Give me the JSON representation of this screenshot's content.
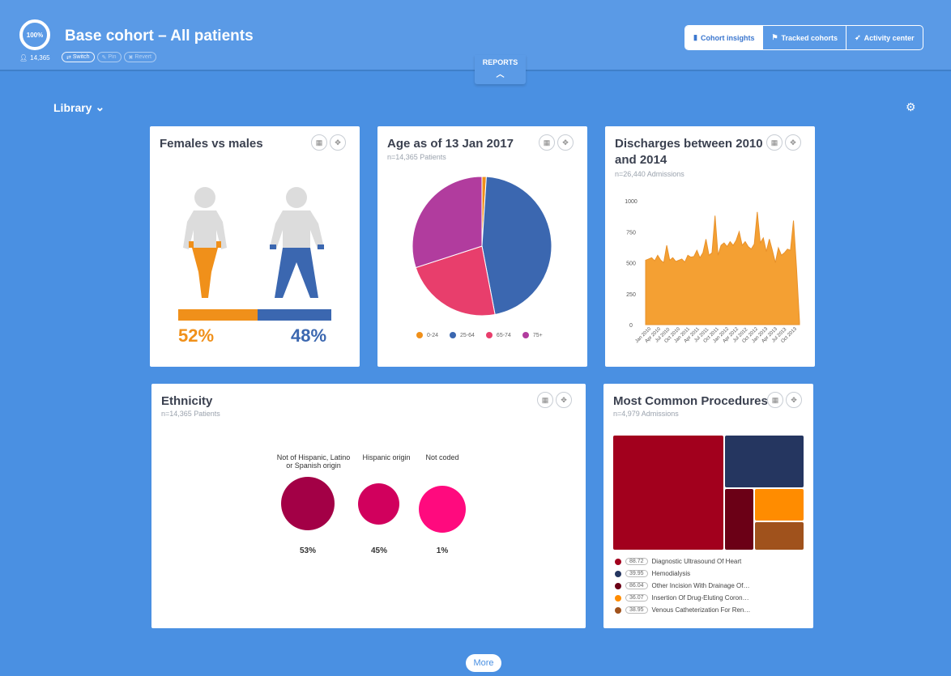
{
  "header": {
    "ring_label": "100%",
    "title": "Base cohort – All patients",
    "patient_count": "14,365",
    "pills": {
      "switch": "Switch",
      "pin": "Pin",
      "revert": "Revert"
    },
    "nav": {
      "insights": "Cohort insights",
      "tracked": "Tracked cohorts",
      "activity": "Activity center"
    },
    "reports": "REPORTS"
  },
  "library": "Library",
  "cards": {
    "gender": {
      "title": "Females vs males",
      "female_pct": "52%",
      "male_pct": "48%",
      "female_share": 0.52
    },
    "age": {
      "title": "Age as of 13 Jan 2017",
      "subtitle": "n=14,365 Patients"
    },
    "discharges": {
      "title_line1": "Discharges between 2010",
      "title_line2": "and 2014",
      "subtitle": "n=26,440 Admissions"
    },
    "ethnicity": {
      "title": "Ethnicity",
      "subtitle": "n=14,365 Patients",
      "groups": [
        {
          "label_line1": "Not of Hispanic, Latino",
          "label_line2": "or Spanish origin",
          "pct": "53%",
          "color": "#a30046"
        },
        {
          "label_line1": "Hispanic origin",
          "label_line2": "",
          "pct": "45%",
          "color": "#d1005d"
        },
        {
          "label_line1": "Not coded",
          "label_line2": "",
          "pct": "1%",
          "color": "#ff0a7e"
        }
      ]
    },
    "procedures": {
      "title": "Most Common Procedures",
      "subtitle": "n=4,979 Admissions",
      "items": [
        {
          "value": "88.72",
          "label": "Diagnostic Ultrasound Of Heart",
          "color": "#a2001d"
        },
        {
          "value": "39.95",
          "label": "Hemodialysis",
          "color": "#253660"
        },
        {
          "value": "86.04",
          "label": "Other Incision With Drainage Of…",
          "color": "#6b0016"
        },
        {
          "value": "36.07",
          "label": "Insertion Of Drug-Eluting Coron…",
          "color": "#ff8c00"
        },
        {
          "value": "38.95",
          "label": "Venous Catheterization For Ren…",
          "color": "#a0521c"
        }
      ]
    }
  },
  "chart_data": [
    {
      "type": "pie",
      "title": "Age as of 13 Jan 2017",
      "labels": [
        "0-24",
        "25-64",
        "65-74",
        "75+"
      ],
      "values": [
        1,
        46,
        23,
        30
      ],
      "colors": [
        "#f0901a",
        "#3b67b0",
        "#e83e6c",
        "#b13c9e"
      ]
    },
    {
      "type": "area",
      "title": "Discharges between 2010 and 2014",
      "ylim": [
        0,
        1000
      ],
      "yticks": [
        0,
        250,
        500,
        750,
        1000
      ],
      "xticks": [
        "Jan 2010",
        "Apr 2010",
        "Jul 2010",
        "Oct 2010",
        "Jan 2011",
        "Apr 2011",
        "Jul 2011",
        "Oct 2011",
        "Jan 2012",
        "Apr 2012",
        "Jul 2012",
        "Oct 2012",
        "Jan 2013",
        "Apr 2013",
        "Jul 2013",
        "Oct 2013"
      ],
      "values": [
        520,
        530,
        540,
        515,
        560,
        520,
        500,
        640,
        520,
        540,
        510,
        520,
        530,
        505,
        560,
        545,
        550,
        600,
        540,
        580,
        690,
        560,
        580,
        880,
        560,
        640,
        660,
        630,
        670,
        640,
        680,
        750,
        640,
        670,
        630,
        610,
        650,
        910,
        660,
        700,
        590,
        690,
        600,
        500,
        620,
        560,
        580,
        610,
        600,
        840,
        460,
        20
      ],
      "color": "#f4a033"
    },
    {
      "type": "treemap",
      "title": "Most Common Procedures",
      "labels": [
        "88.72",
        "39.95",
        "86.04",
        "36.07",
        "38.95"
      ],
      "values": [
        1000,
        280,
        120,
        120,
        100
      ],
      "colors": [
        "#a2001d",
        "#253660",
        "#6b0016",
        "#ff8c00",
        "#a0521c"
      ]
    }
  ],
  "more": "More"
}
